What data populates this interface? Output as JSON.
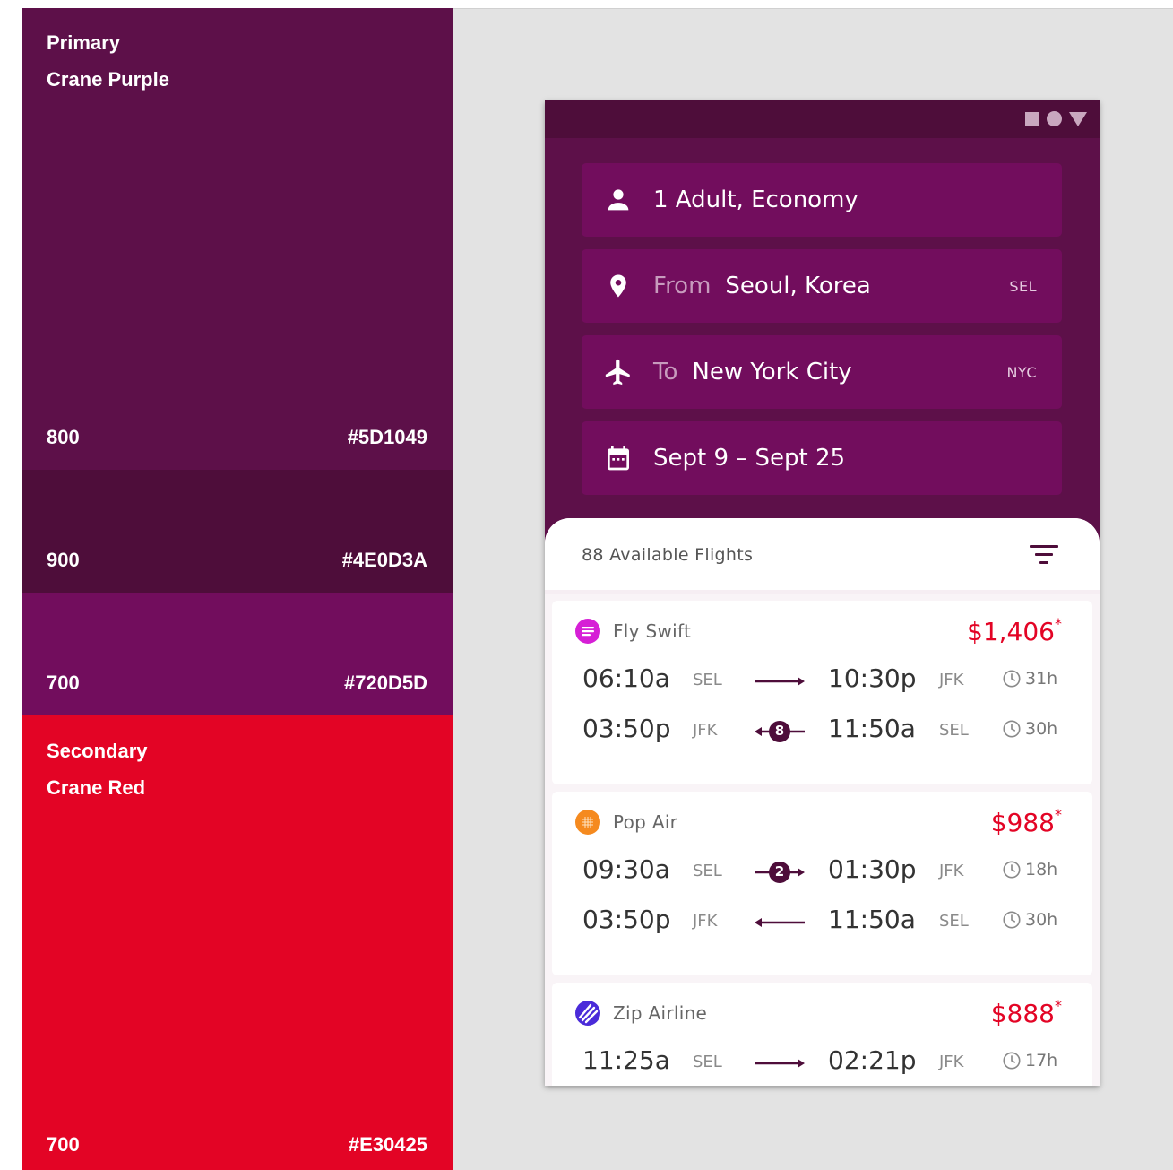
{
  "palette": {
    "primary": {
      "group_label": "Primary",
      "name": "Crane Purple",
      "shades": [
        {
          "shade": "800",
          "hex": "#5D1049",
          "color": "#5D1049"
        },
        {
          "shade": "900",
          "hex": "#4E0D3A",
          "color": "#4E0D3A"
        },
        {
          "shade": "700",
          "hex": "#720D5D",
          "color": "#720D5D"
        }
      ]
    },
    "secondary": {
      "group_label": "Secondary",
      "name": "Crane Red",
      "shades": [
        {
          "shade": "700",
          "hex": "#E30425",
          "color": "#E30425"
        }
      ]
    }
  },
  "app": {
    "status_icons": [
      "square-icon",
      "circle-icon",
      "triangle-icon"
    ],
    "fields": {
      "passengers": {
        "icon": "person-icon",
        "value": "1 Adult, Economy"
      },
      "from": {
        "icon": "location-pin-icon",
        "prefix": "From",
        "value": "Seoul, Korea",
        "code": "SEL"
      },
      "to": {
        "icon": "airplane-icon",
        "prefix": "To",
        "value": "New York City",
        "code": "NYC"
      },
      "dates": {
        "icon": "calendar-icon",
        "value": "Sept 9 – Sept 25"
      }
    },
    "results": {
      "count_label": "88 Available Flights",
      "filter_icon": "filter-icon",
      "flights": [
        {
          "airline": "Fly Swift",
          "logo_color": "#d61fd6",
          "price": "$1,406",
          "price_mark": "*",
          "legs": [
            {
              "depart_time": "06:10a",
              "depart_code": "SEL",
              "stops": "",
              "direction": "right",
              "arrive_time": "10:30p",
              "arrive_code": "JFK",
              "duration": "31h"
            },
            {
              "depart_time": "03:50p",
              "depart_code": "JFK",
              "stops": "8",
              "direction": "left",
              "arrive_time": "11:50a",
              "arrive_code": "SEL",
              "duration": "30h"
            }
          ]
        },
        {
          "airline": "Pop Air",
          "logo_color": "#f58a1f",
          "price": "$988",
          "price_mark": "*",
          "legs": [
            {
              "depart_time": "09:30a",
              "depart_code": "SEL",
              "stops": "2",
              "direction": "right",
              "arrive_time": "01:30p",
              "arrive_code": "JFK",
              "duration": "18h"
            },
            {
              "depart_time": "03:50p",
              "depart_code": "JFK",
              "stops": "",
              "direction": "left",
              "arrive_time": "11:50a",
              "arrive_code": "SEL",
              "duration": "30h"
            }
          ]
        },
        {
          "airline": "Zip Airline",
          "logo_color": "#4a2bd9",
          "price": "$888",
          "price_mark": "*",
          "legs": [
            {
              "depart_time": "11:25a",
              "depart_code": "SEL",
              "stops": "",
              "direction": "right",
              "arrive_time": "02:21p",
              "arrive_code": "JFK",
              "duration": "17h"
            }
          ]
        }
      ]
    }
  }
}
